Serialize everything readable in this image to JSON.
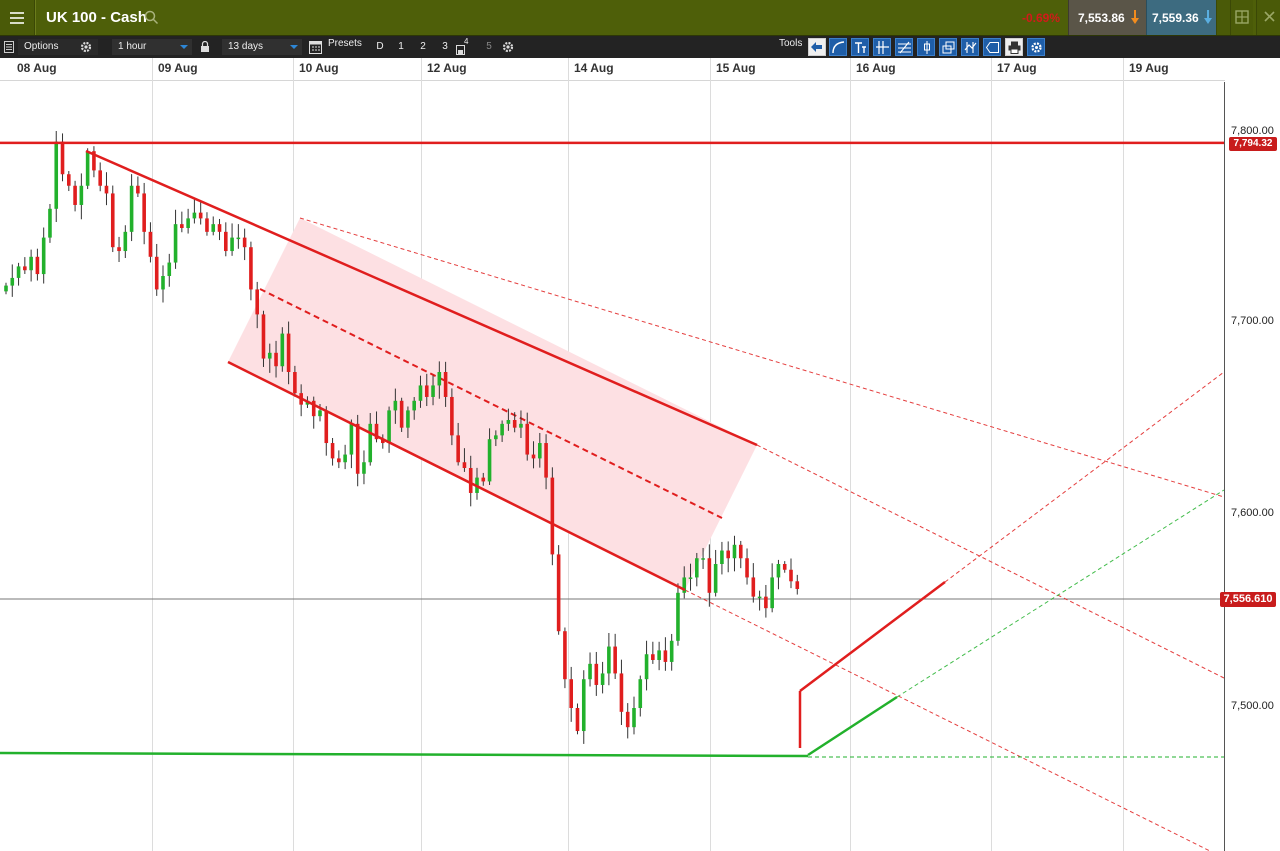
{
  "title_bar": {
    "instrument": "UK 100 - Cash",
    "change": "-0.69%",
    "sell_price": "7,553.86",
    "buy_price": "7,559.36"
  },
  "toolbar": {
    "options_label": "Options",
    "interval": "1 hour",
    "range": "13 days",
    "presets_label": "Presets",
    "presets": [
      "D",
      "1",
      "2",
      "3",
      "4",
      "5"
    ],
    "tools_label": "Tools"
  },
  "date_axis": [
    "08 Aug",
    "09 Aug",
    "10 Aug",
    "12 Aug",
    "14 Aug",
    "15 Aug",
    "16 Aug",
    "17 Aug",
    "19 Aug"
  ],
  "price_axis": [
    "7,800.00",
    "7,700.00",
    "7,600.00",
    "7,500.00"
  ],
  "resistance_tag": "7,794.32",
  "current_price_tag": "7,556.610",
  "colors": {
    "bull": "#22b12c",
    "bear": "#e01e1e",
    "title_bar": "#4e5f09",
    "toolbar": "#232323",
    "channel_fill": "#fde0e3"
  },
  "chart_data": {
    "type": "candlestick",
    "instrument": "UK 100 - Cash",
    "interval": "1 hour",
    "ylim": [
      7420,
      7820
    ],
    "y_ticks": [
      7500,
      7600,
      7700,
      7800
    ],
    "x_ticks": [
      "08 Aug",
      "09 Aug",
      "10 Aug",
      "12 Aug",
      "14 Aug",
      "15 Aug",
      "16 Aug",
      "17 Aug",
      "19 Aug"
    ],
    "close_series": [
      7720,
      7724,
      7730,
      7728,
      7735,
      7726,
      7745,
      7760,
      7795,
      7778,
      7772,
      7762,
      7772,
      7790,
      7780,
      7772,
      7768,
      7740,
      7738,
      7748,
      7772,
      7768,
      7748,
      7735,
      7718,
      7725,
      7732,
      7752,
      7750,
      7755,
      7758,
      7755,
      7748,
      7752,
      7748,
      7738,
      7745,
      7745,
      7740,
      7718,
      7705,
      7682,
      7685,
      7678,
      7695,
      7675,
      7664,
      7658,
      7660,
      7652,
      7655,
      7638,
      7630,
      7628,
      7632,
      7648,
      7622,
      7628,
      7648,
      7640,
      7638,
      7655,
      7660,
      7646,
      7655,
      7660,
      7668,
      7662,
      7668,
      7675,
      7662,
      7642,
      7628,
      7625,
      7612,
      7620,
      7618,
      7640,
      7642,
      7648,
      7650,
      7646,
      7648,
      7632,
      7630,
      7638,
      7620,
      7580,
      7540,
      7515,
      7500,
      7488,
      7515,
      7523,
      7512,
      7518,
      7532,
      7518,
      7498,
      7490,
      7500,
      7515,
      7528,
      7525,
      7530,
      7524,
      7535,
      7560,
      7568,
      7568,
      7578,
      7578,
      7560,
      7575,
      7582,
      7578,
      7585,
      7578,
      7568,
      7558,
      7558,
      7552,
      7568,
      7575,
      7572,
      7566,
      7562
    ],
    "annotations": [
      {
        "type": "horizontal",
        "label": "resistance",
        "price": 7794.32
      },
      {
        "type": "horizontal",
        "label": "support",
        "price": 7475
      },
      {
        "type": "trendline",
        "label": "descending channel top",
        "x": [
          "08 Aug",
          "15 Aug"
        ],
        "y": [
          7795,
          7640
        ]
      },
      {
        "type": "trendline",
        "label": "rising wedge top",
        "x": [
          "15 Aug",
          "16 Aug"
        ],
        "y": [
          7510,
          7570
        ]
      },
      {
        "type": "trendline",
        "label": "rising wedge bottom",
        "x": [
          "15 Aug",
          "16 Aug"
        ],
        "y": [
          7475,
          7505
        ]
      }
    ]
  }
}
